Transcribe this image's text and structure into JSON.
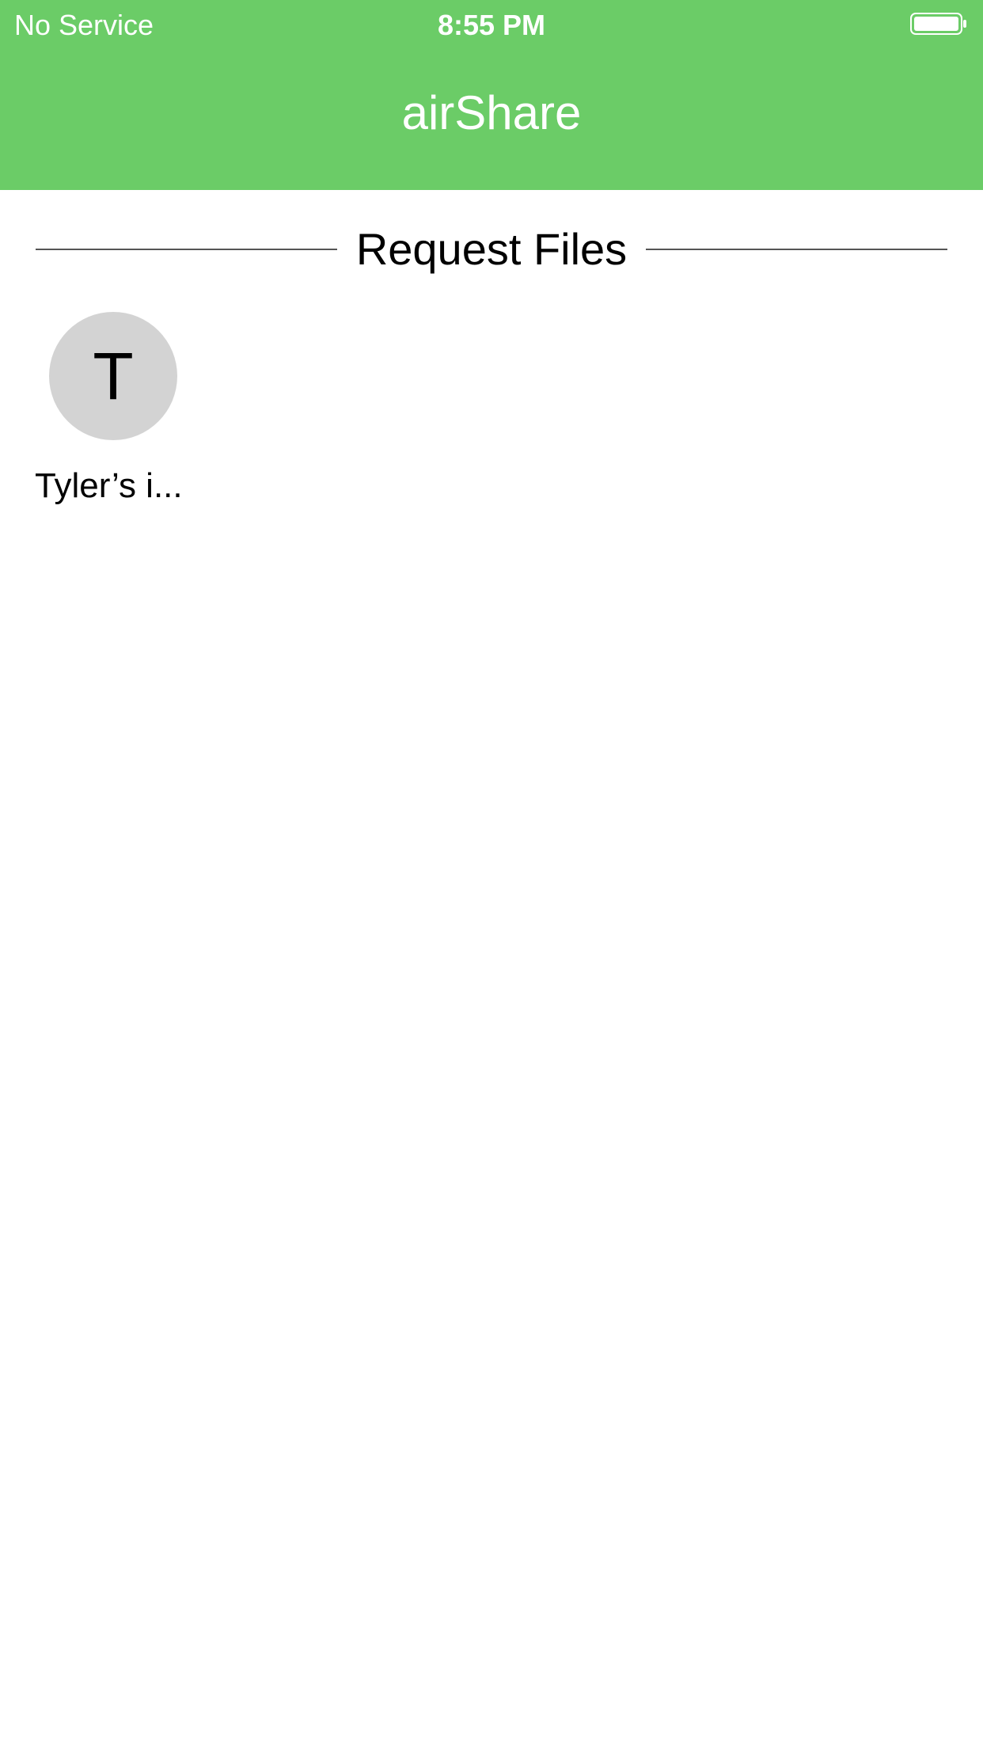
{
  "status_bar": {
    "carrier": "No Service",
    "time": "8:55 PM",
    "battery_icon": "battery-full-icon"
  },
  "nav": {
    "title": "airShare",
    "background_color": "#6bcc67"
  },
  "section": {
    "title": "Request Files"
  },
  "devices": [
    {
      "initial": "T",
      "name": "Tyler’s i..."
    }
  ]
}
